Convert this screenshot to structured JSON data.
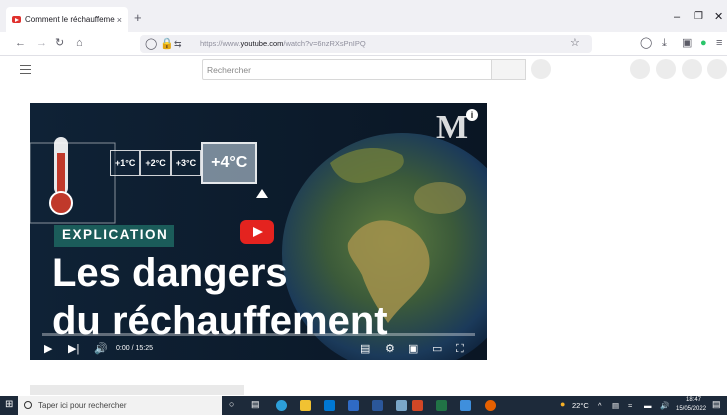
{
  "browser": {
    "tab_title": "Comment le réchauffement cli",
    "tab_close": "×",
    "new_tab": "+",
    "url_prefix": "https://www.",
    "url_domain": "youtube.com",
    "url_path": "/watch?v=6nzRXsPnIPQ"
  },
  "youtube": {
    "search_placeholder": "Rechercher"
  },
  "thumbnail": {
    "temps": [
      "+1°C",
      "+2°C",
      "+3°C"
    ],
    "temp_highlight": "+4°C",
    "tag": "EXPLICATION",
    "headline_line1": "Les dangers",
    "headline_line2": "du réchauffement",
    "logo_letter": "M",
    "info": "i"
  },
  "player": {
    "time": "0:00 / 15:25",
    "progress": 0.0
  },
  "taskbar": {
    "search_placeholder": "Taper ici pour rechercher",
    "weather": "22°C",
    "clock_time": "18:47",
    "clock_date": "15/05/2022"
  },
  "colors": {
    "youtube_red": "#e4231f",
    "explication_tag": "#1b5c5a",
    "taskbar": "#1d2a3a",
    "tab_strip": "#f0f0f4"
  }
}
